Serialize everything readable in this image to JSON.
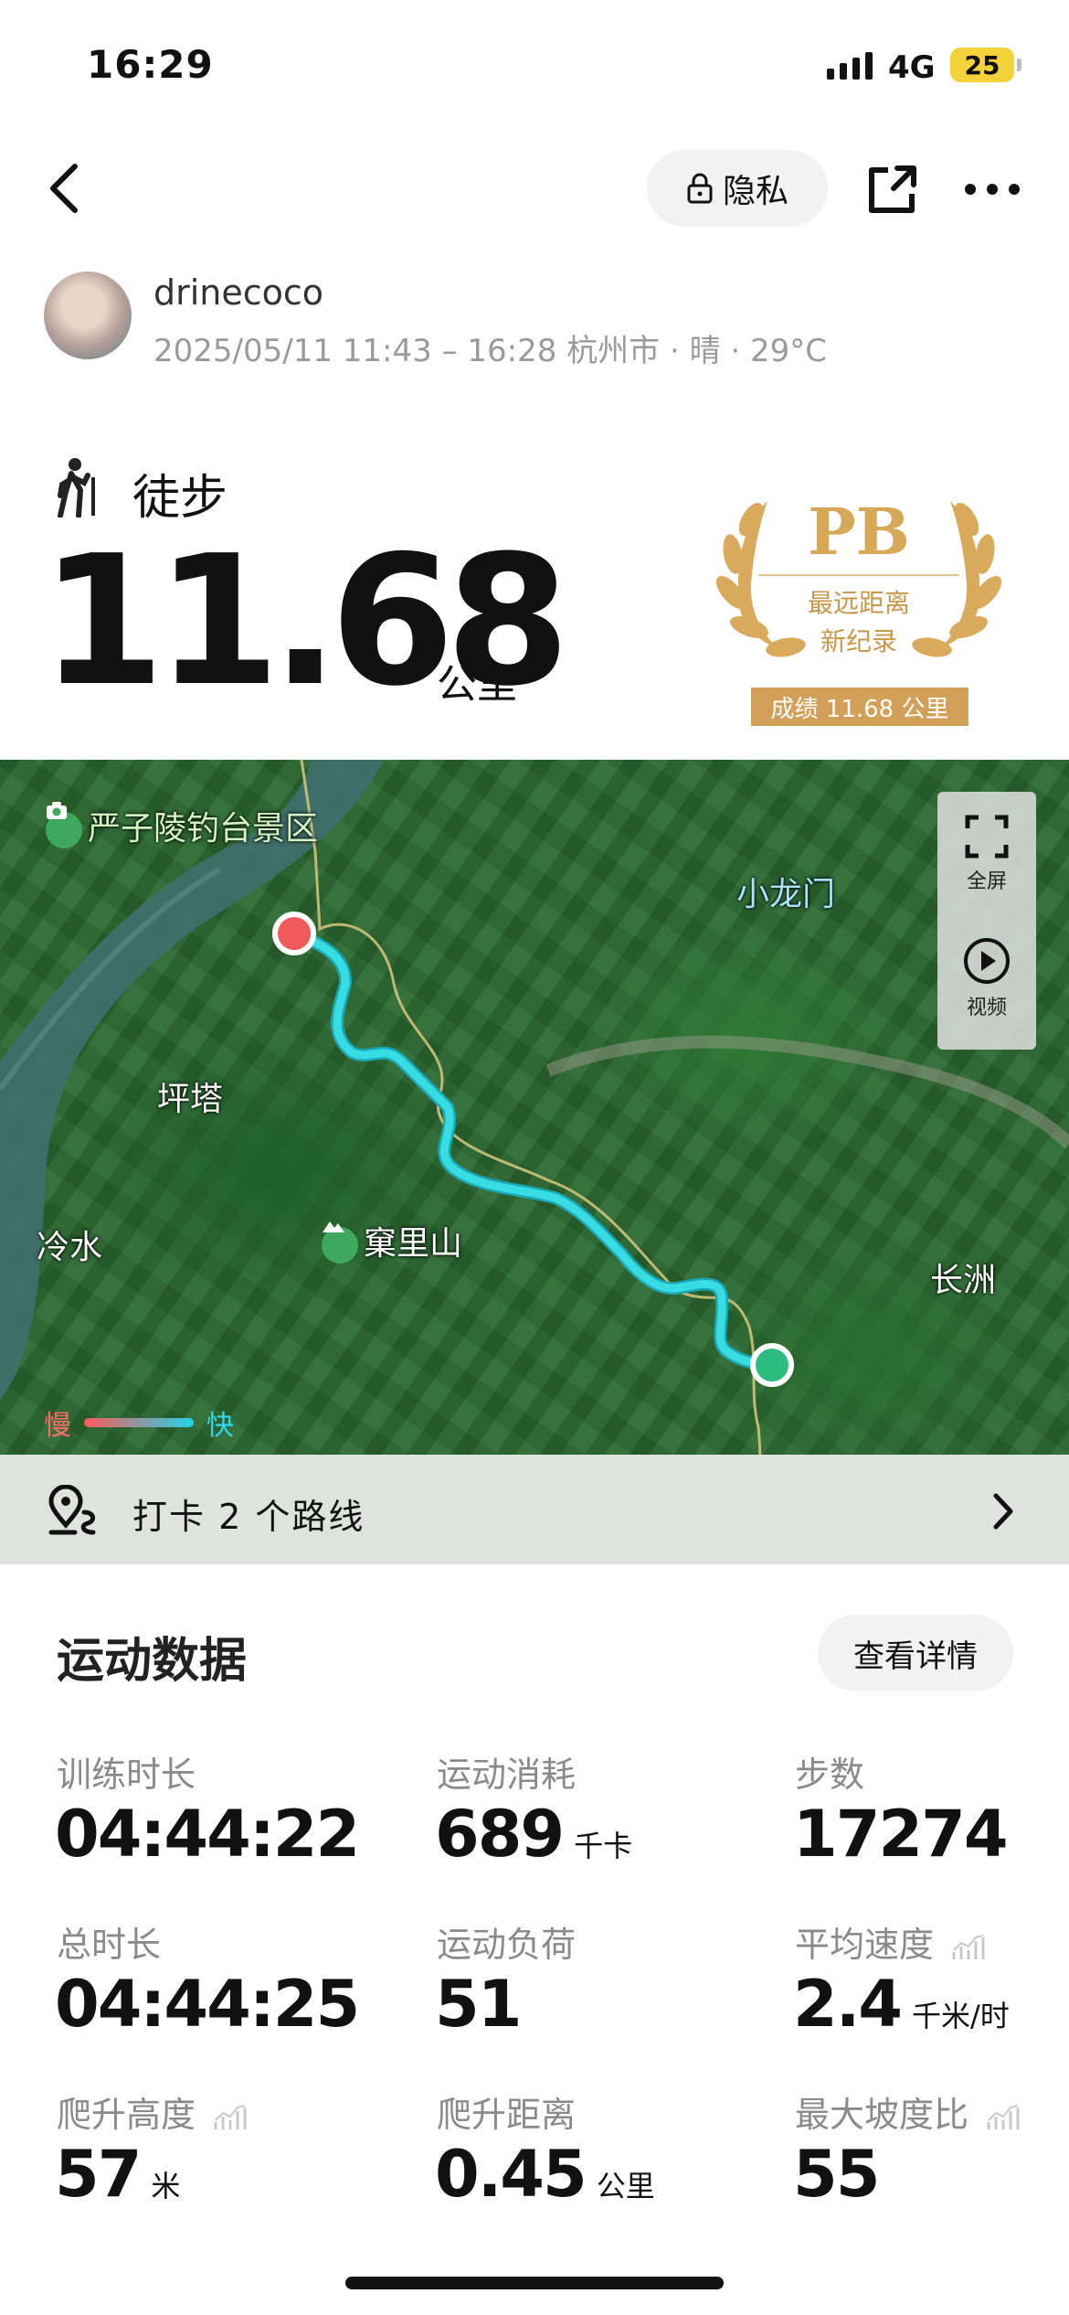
{
  "status_bar": {
    "time": "16:29",
    "network": "4G",
    "battery": "25"
  },
  "header": {
    "privacy_label": "隐私"
  },
  "user": {
    "name": "drinecoco",
    "meta": "2025/05/11 11:43 – 16:28 杭州市 · 晴 · 29°C"
  },
  "activity": {
    "type": "徒步",
    "distance": "11.68",
    "distance_unit": "公里"
  },
  "pb_badge": {
    "title": "PB",
    "line1": "最远距离",
    "line2": "新纪录",
    "score": "成绩 11.68 公里"
  },
  "map": {
    "labels": {
      "scenic": "严子陵钓台景区",
      "xiaolongmen": "小龙门",
      "pingta": "坪塔",
      "lengshui": "冷水",
      "mountain": "窠里山",
      "changzhou": "长洲"
    },
    "controls": {
      "fullscreen": "全屏",
      "video": "视频"
    },
    "speed_legend": {
      "slow": "慢",
      "fast": "快"
    }
  },
  "route_checkin": {
    "text": "打卡 2 个路线"
  },
  "stats_section": {
    "title": "运动数据",
    "detail_button": "查看详情",
    "items": [
      {
        "label": "训练时长",
        "value": "04:44:22",
        "unit": ""
      },
      {
        "label": "运动消耗",
        "value": "689",
        "unit": "千卡"
      },
      {
        "label": "步数",
        "value": "17274",
        "unit": ""
      },
      {
        "label": "总时长",
        "value": "04:44:25",
        "unit": ""
      },
      {
        "label": "运动负荷",
        "value": "51",
        "unit": ""
      },
      {
        "label": "平均速度",
        "value": "2.4",
        "unit": "千米/时"
      },
      {
        "label": "爬升高度",
        "value": "57",
        "unit": "米"
      },
      {
        "label": "爬升距离",
        "value": "0.45",
        "unit": "公里"
      },
      {
        "label": "最大坡度比",
        "value": "55",
        "unit": ""
      }
    ]
  },
  "colors": {
    "route": "#2fd0d6",
    "start": "#2bbd7e",
    "end": "#f05a5a",
    "pb_gold": "#d3a05a"
  }
}
